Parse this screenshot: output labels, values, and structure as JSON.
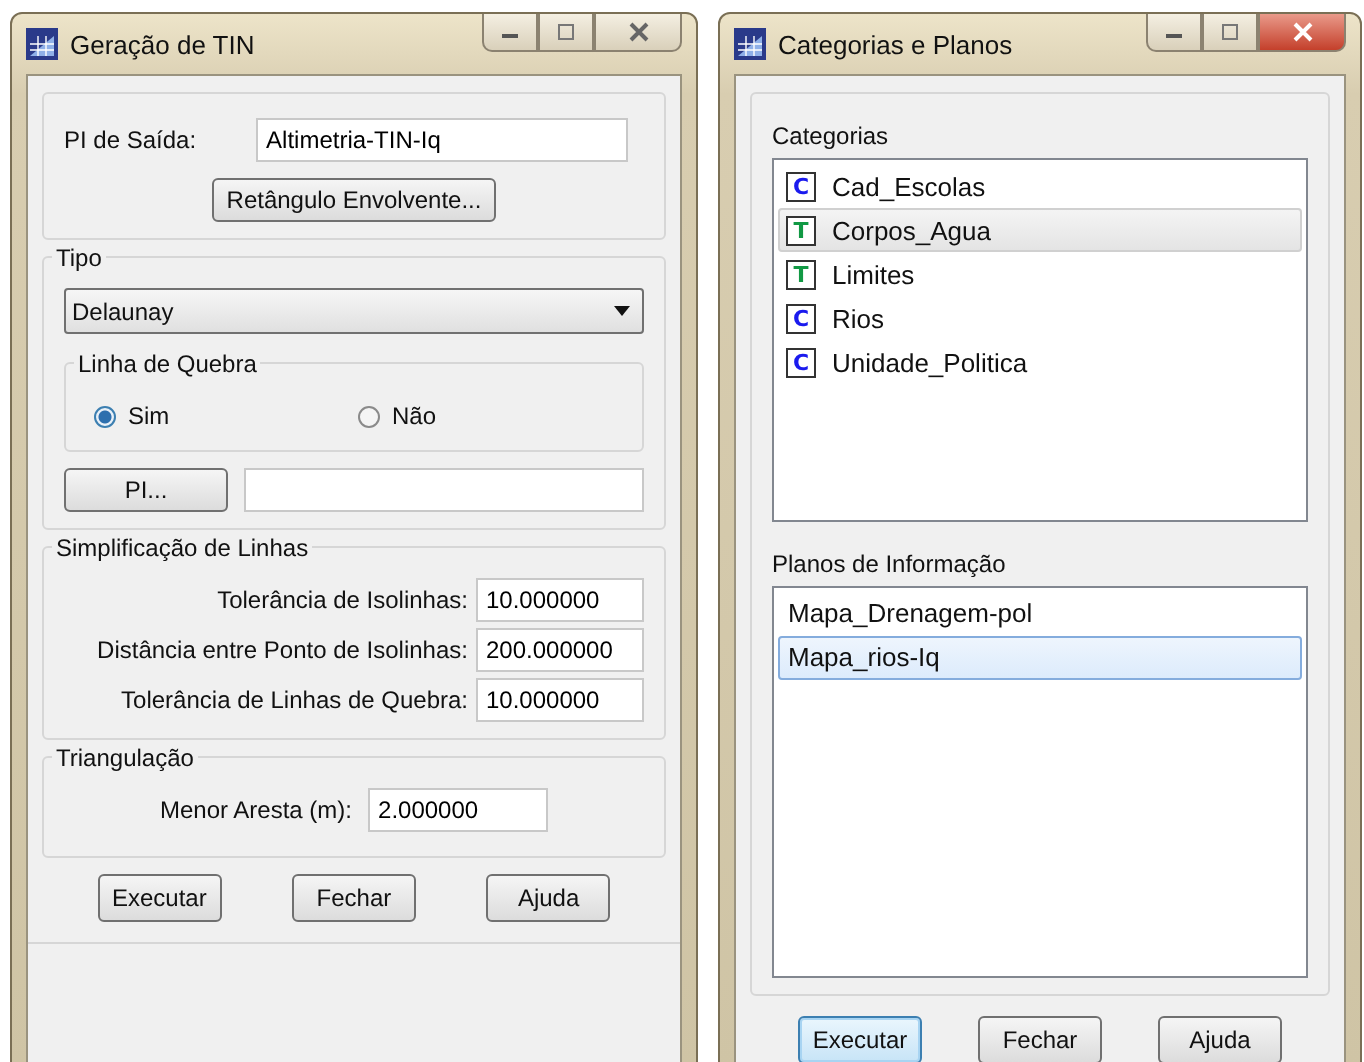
{
  "tin_window": {
    "title": "Geração de TIN",
    "output": {
      "label": "PI de Saída:",
      "value": "Altimetria-TIN-Iq",
      "bounds_button": "Retângulo Envolvente..."
    },
    "tipo": {
      "title": "Tipo",
      "dropdown": "Delaunay",
      "linha_de_quebra": {
        "title": "Linha de Quebra",
        "options": [
          {
            "label": "Sim",
            "selected": true
          },
          {
            "label": "Não",
            "selected": false
          }
        ]
      },
      "pi_button": "PI..."
    },
    "simplificacao": {
      "title": "Simplificação de Linhas",
      "fields": [
        {
          "label": "Tolerância de Isolinhas:",
          "value": "10.000000"
        },
        {
          "label": "Distância entre Ponto de Isolinhas:",
          "value": "200.000000"
        },
        {
          "label": "Tolerância de Linhas de Quebra:",
          "value": "10.000000"
        }
      ]
    },
    "triangulacao": {
      "title": "Triangulação",
      "field": {
        "label": "Menor Aresta (m):",
        "value": "2.000000"
      }
    },
    "buttons": [
      {
        "label": "Executar",
        "focused": false
      },
      {
        "label": "Fechar",
        "focused": false
      },
      {
        "label": "Ajuda",
        "focused": false
      }
    ]
  },
  "categories_window": {
    "title": "Categorias e Planos",
    "categorias": {
      "title": "Categorias",
      "items": [
        {
          "badge": "C",
          "color": "#1a1aee",
          "name": "Cad_Escolas",
          "highlighted": false
        },
        {
          "badge": "T",
          "color": "#119944",
          "name": "Corpos_Agua",
          "highlighted": true
        },
        {
          "badge": "T",
          "color": "#119944",
          "name": "Limites",
          "highlighted": false
        },
        {
          "badge": "C",
          "color": "#1a1aee",
          "name": "Rios",
          "highlighted": false
        },
        {
          "badge": "C",
          "color": "#1a1aee",
          "name": "Unidade_Politica",
          "highlighted": false
        }
      ]
    },
    "planos": {
      "title": "Planos de Informação",
      "items": [
        {
          "name": "Mapa_Drenagem-pol",
          "selected": false
        },
        {
          "name": "Mapa_rios-Iq",
          "selected": true
        }
      ]
    },
    "buttons": [
      {
        "label": "Executar",
        "focused": true
      },
      {
        "label": "Fechar",
        "focused": false
      },
      {
        "label": "Ajuda",
        "focused": false
      }
    ]
  }
}
